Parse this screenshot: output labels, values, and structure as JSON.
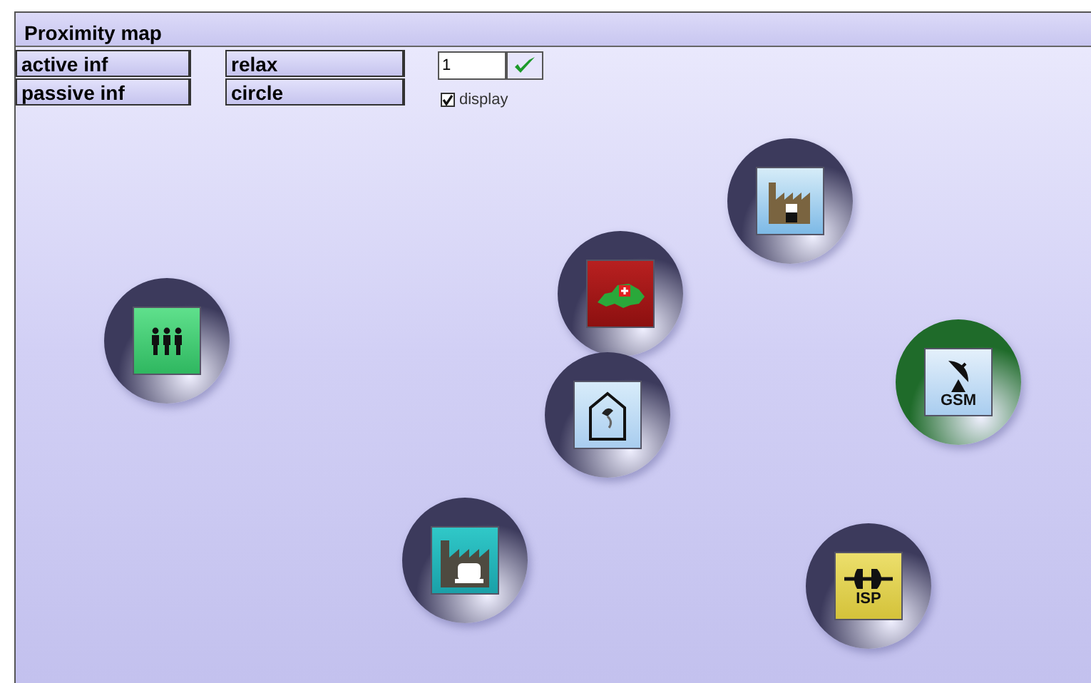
{
  "window": {
    "title": "Proximity map"
  },
  "buttons": [
    {
      "label": "active inf"
    },
    {
      "label": "relax"
    },
    {
      "label": "passive inf"
    },
    {
      "label": "circle"
    }
  ],
  "count_field": {
    "value": "1"
  },
  "display": {
    "label": "display",
    "checked": true
  },
  "nodes": [
    {
      "kind": "people",
      "color": "#3c3a5c"
    },
    {
      "kind": "swiss-map",
      "color": "#3c3a5c"
    },
    {
      "kind": "house",
      "color": "#3c3a5c"
    },
    {
      "kind": "factory",
      "color": "#3c3a5c"
    },
    {
      "kind": "satellite",
      "color": "#1f6b2a",
      "label": "GSM"
    },
    {
      "kind": "factory-teal",
      "color": "#3c3a5c"
    },
    {
      "kind": "plug",
      "color": "#3c3a5c",
      "label": "ISP"
    }
  ]
}
